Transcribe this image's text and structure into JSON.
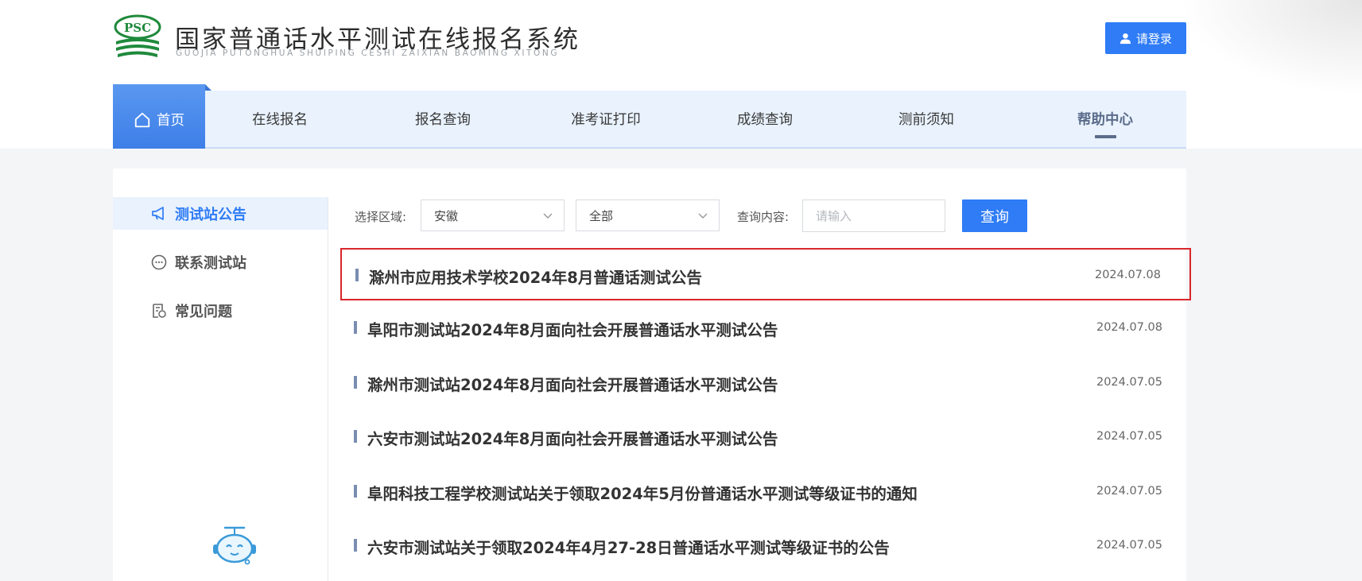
{
  "header": {
    "logo_text": "PSC",
    "title": "国家普通话水平测试在线报名系统",
    "subtitle": "GUOJIA PUTONGHUA SHUIPING CESHI ZAIXIAN BAOMING XITONG",
    "login_label": "请登录"
  },
  "nav": {
    "items": [
      {
        "label": "首页"
      },
      {
        "label": "在线报名"
      },
      {
        "label": "报名查询"
      },
      {
        "label": "准考证打印"
      },
      {
        "label": "成绩查询"
      },
      {
        "label": "测前须知"
      },
      {
        "label": "帮助中心"
      }
    ]
  },
  "sidebar": {
    "items": [
      {
        "label": "测试站公告",
        "icon": "megaphone-icon",
        "active": true
      },
      {
        "label": "联系测试站",
        "icon": "chat-icon",
        "active": false
      },
      {
        "label": "常见问题",
        "icon": "faq-icon",
        "active": false
      }
    ]
  },
  "filter": {
    "region_label": "选择区域:",
    "region_value": "安徽",
    "sub_value": "全部",
    "query_label": "查询内容:",
    "query_placeholder": "请输入",
    "query_button": "查询"
  },
  "notices": [
    {
      "title": "滁州市应用技术学校2024年8月普通话测试公告",
      "date": "2024.07.08"
    },
    {
      "title": "阜阳市测试站2024年8月面向社会开展普通话水平测试公告",
      "date": "2024.07.08"
    },
    {
      "title": "滁州市测试站2024年8月面向社会开展普通话水平测试公告",
      "date": "2024.07.05"
    },
    {
      "title": "六安市测试站2024年8月面向社会开展普通话水平测试公告",
      "date": "2024.07.05"
    },
    {
      "title": "阜阳科技工程学校测试站关于领取2024年5月份普通话水平测试等级证书的通知",
      "date": "2024.07.05"
    },
    {
      "title": "六安市测试站关于领取2024年4月27-28日普通话水平测试等级证书的公告",
      "date": "2024.07.05"
    }
  ],
  "colors": {
    "accent": "#2f7cf6",
    "nav_bg": "#e9f2fd",
    "highlight_border": "#d9262c",
    "logo_green": "#1f8a3c"
  }
}
